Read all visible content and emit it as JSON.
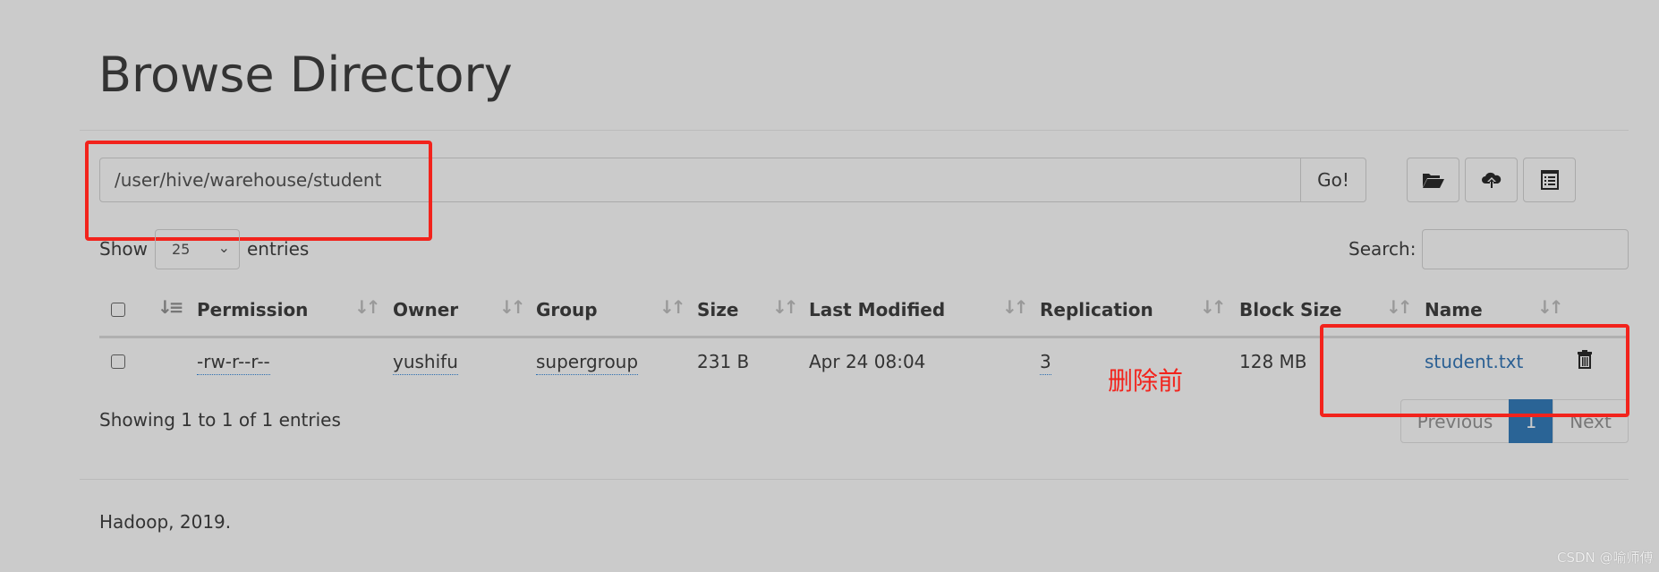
{
  "page": {
    "title": "Browse Directory"
  },
  "path_bar": {
    "value": "/user/hive/warehouse/student",
    "go_label": "Go!"
  },
  "toolbar": {
    "icons": [
      "folder-open-icon",
      "cloud-upload-icon",
      "list-icon"
    ]
  },
  "table_controls": {
    "show_label": "Show",
    "entries_value": "25",
    "entries_label": "entries",
    "search_label": "Search:",
    "search_value": ""
  },
  "table": {
    "columns": [
      "Permission",
      "Owner",
      "Group",
      "Size",
      "Last Modified",
      "Replication",
      "Block Size",
      "Name"
    ],
    "rows": [
      {
        "permission": "-rw-r--r--",
        "owner": "yushifu",
        "group": "supergroup",
        "size": "231 B",
        "last_modified": "Apr 24 08:04",
        "replication": "3",
        "block_size": "128 MB",
        "name": "student.txt"
      }
    ]
  },
  "info": "Showing 1 to 1 of 1 entries",
  "pagination": {
    "previous": "Previous",
    "current": "1",
    "next": "Next"
  },
  "annotation": {
    "text": "删除前",
    "color": "#f2231c"
  },
  "footer": "Hadoop, 2019.",
  "watermark": "CSDN @喻师傅",
  "colors": {
    "background": "#cbcbcb",
    "link": "#2a5f93",
    "active_page": "#2a6496",
    "annotation_red": "#f2231c"
  }
}
